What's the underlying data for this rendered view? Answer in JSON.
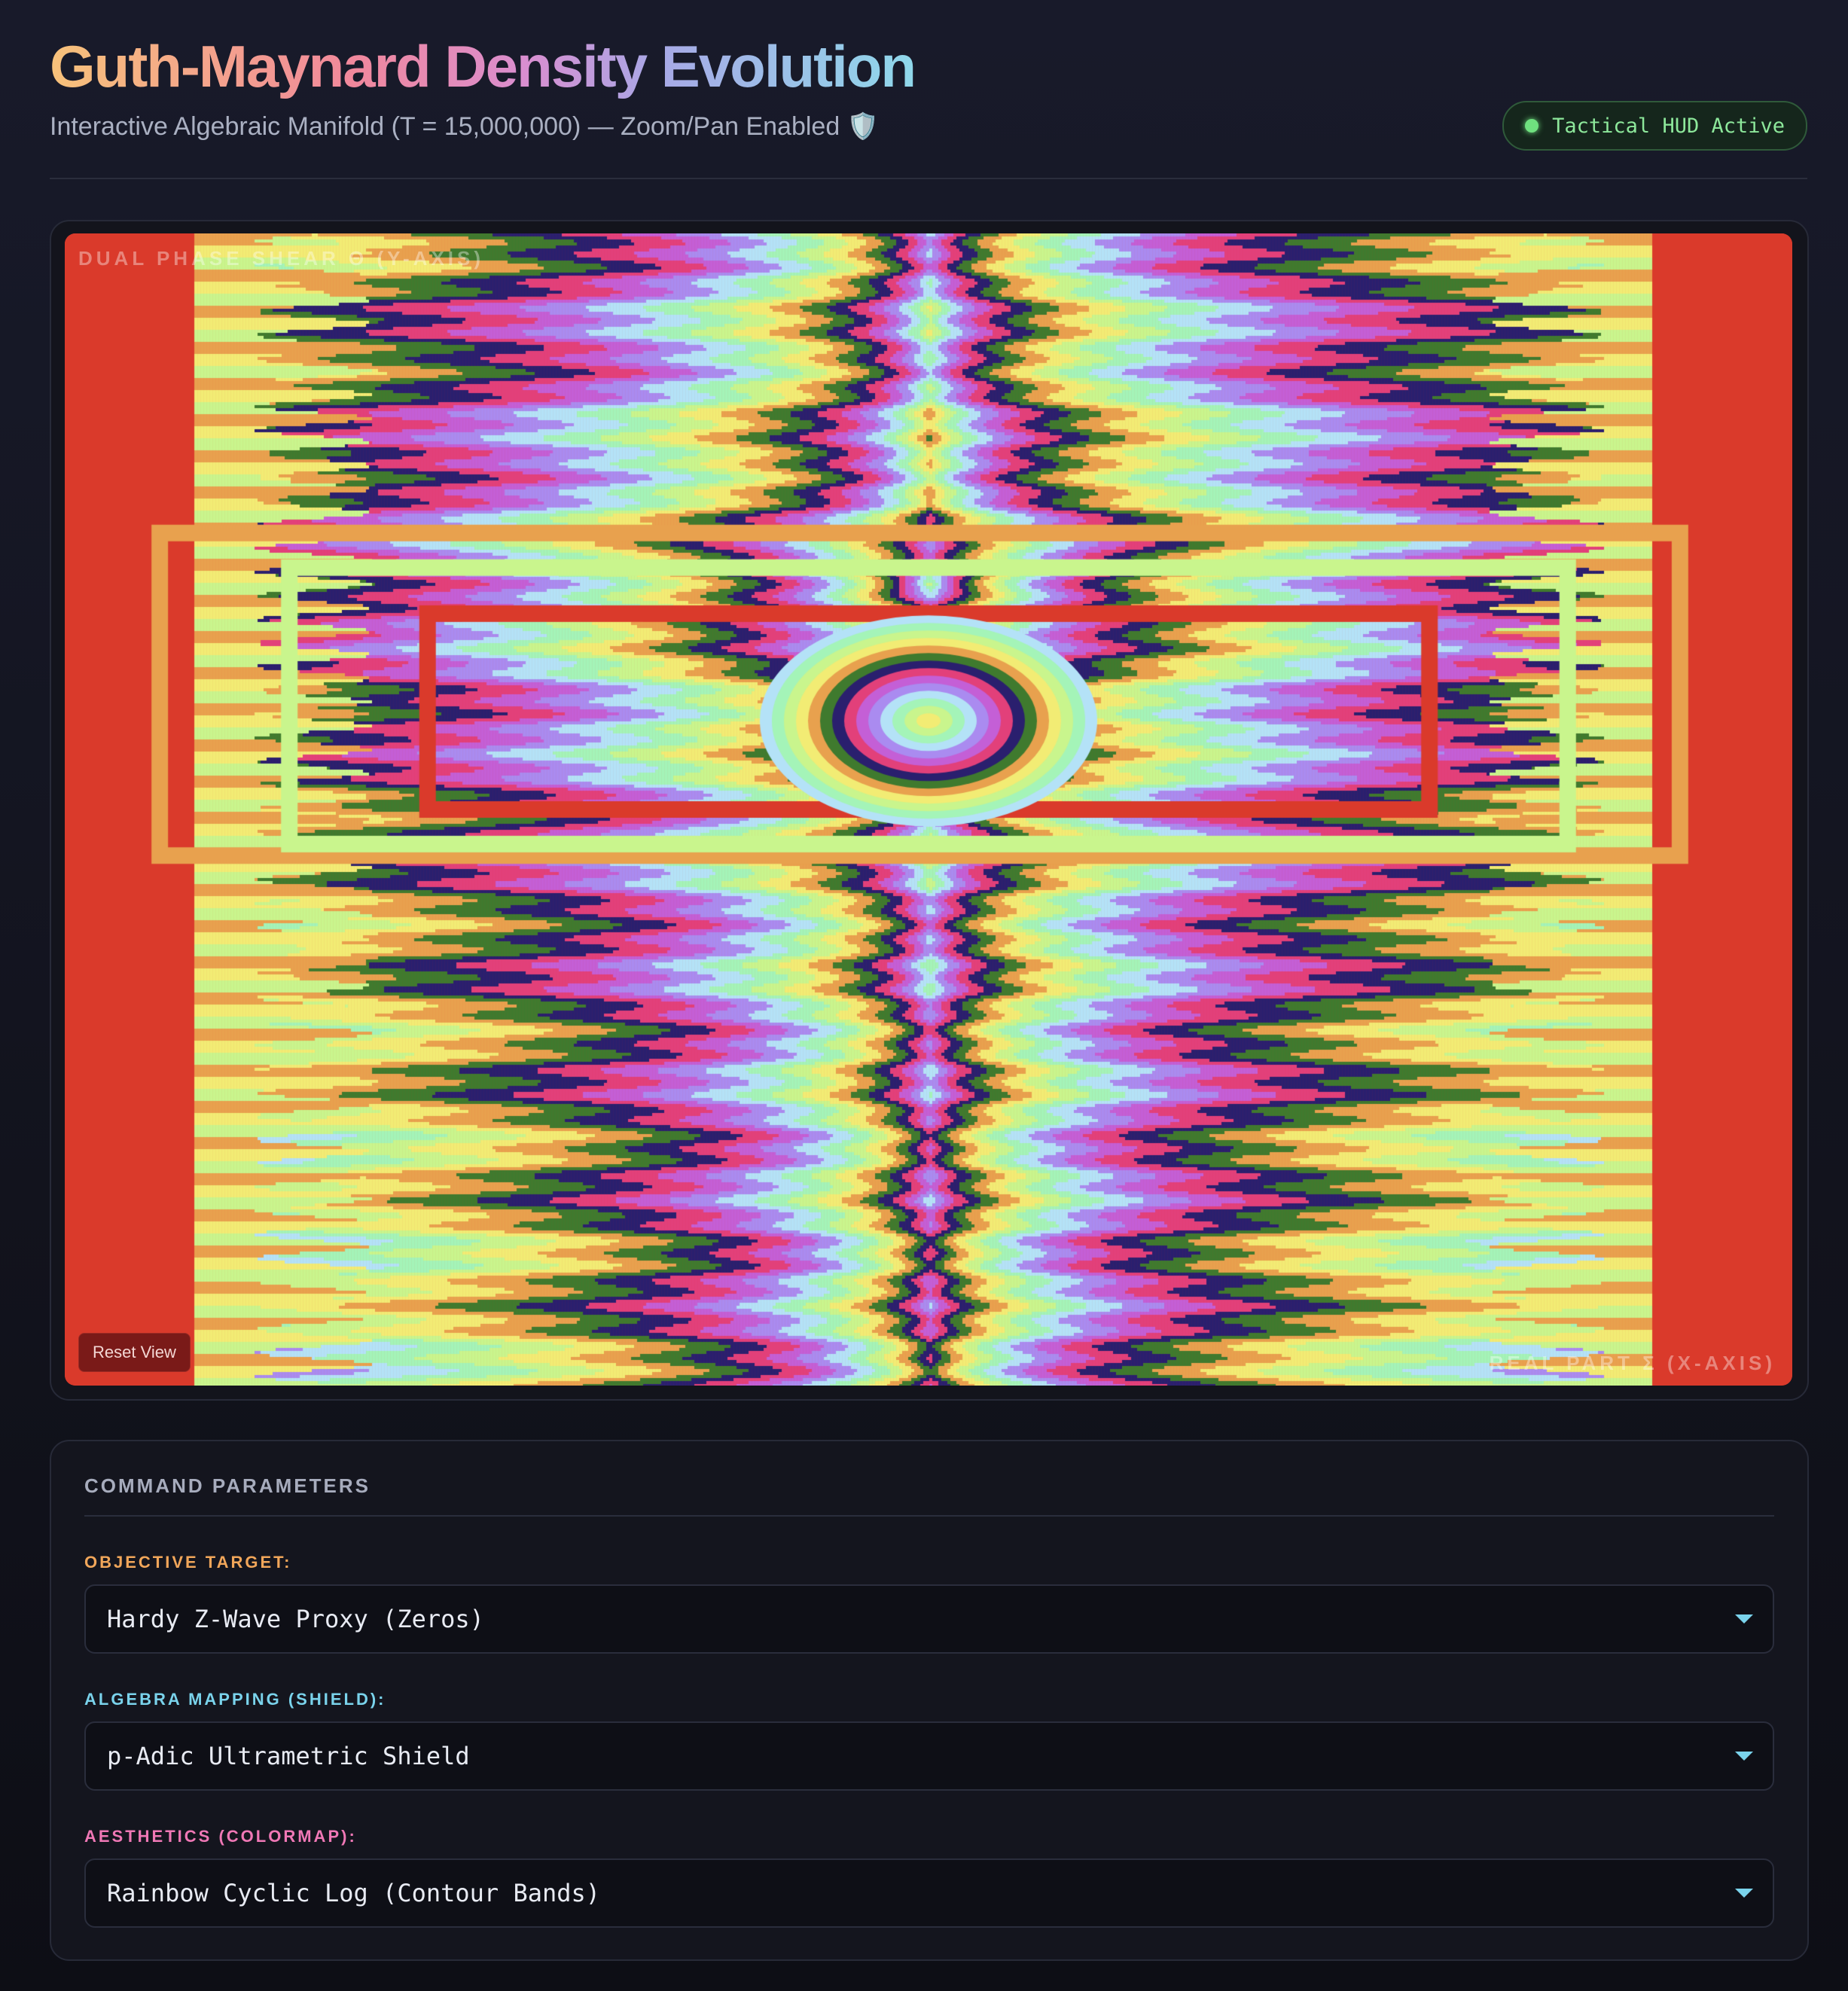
{
  "header": {
    "title": "Guth-Maynard Density Evolution",
    "subtitle": "Interactive Algebraic Manifold (T = 15,000,000) — Zoom/Pan Enabled 🛡️",
    "status_badge": "Tactical HUD Active"
  },
  "visualization": {
    "y_axis_label": "DUAL PHASE SHEAR Θ (Y-AXIS)",
    "x_axis_label": "REAL PART Σ (X-AXIS)",
    "reset_button": "Reset View",
    "palette": [
      "#da3a2b",
      "#e8a14e",
      "#f2ec74",
      "#c9f58d",
      "#a4f4b8",
      "#b4e2f7",
      "#aa8bf0",
      "#c45fd6",
      "#e2407a",
      "#2a1f6e",
      "#3f7a2e"
    ]
  },
  "params": {
    "heading": "COMMAND PARAMETERS",
    "objective": {
      "label": "OBJECTIVE TARGET:",
      "value": "Hardy Z-Wave Proxy (Zeros)",
      "color": "#f1a65a"
    },
    "algebra": {
      "label": "ALGEBRA MAPPING (SHIELD):",
      "value": "p-Adic Ultrametric Shield",
      "color": "#7ad3ec"
    },
    "aesthetics": {
      "label": "AESTHETICS (COLORMAP):",
      "value": "Rainbow Cyclic Log (Contour Bands)",
      "color": "#f078b6"
    }
  }
}
